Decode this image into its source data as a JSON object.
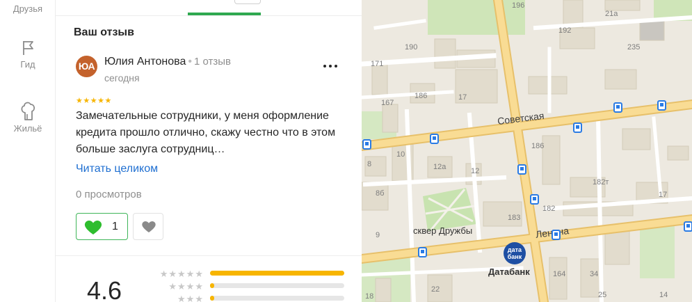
{
  "nav": {
    "items": [
      {
        "label": "Друзья",
        "icon": "friends-icon"
      },
      {
        "label": "Гид",
        "icon": "flag-icon"
      },
      {
        "label": "Жильё",
        "icon": "housing-icon"
      }
    ]
  },
  "review_section": {
    "title": "Ваш отзыв",
    "author": {
      "avatar_initials": "ЮА",
      "avatar_color": "#c4622c",
      "name": "Юлия Антонова",
      "reviews_count": "1 отзыв",
      "date": "сегодня"
    },
    "stars": "★★★★★",
    "rating_value": 5,
    "text": "Замечательные сотрудники, у меня оформление кредита прошло отлично, скажу честно что в этом больше заслуга сотрудниц…",
    "read_more": "Читать целиком",
    "views": "0 просмотров",
    "likes": {
      "count": "1",
      "icon": "green-heart-icon"
    },
    "dislike": {
      "icon": "gray-heart-icon"
    }
  },
  "summary": {
    "rating": "4.6",
    "distribution": [
      {
        "stars": "★★★★★",
        "fraction": 1.0
      },
      {
        "stars": "★★★★",
        "fraction": 0.03
      },
      {
        "stars": "★★★",
        "fraction": 0.03
      }
    ]
  },
  "map": {
    "streets": [
      "Советская",
      "Ленина"
    ],
    "places": [
      "сквер Дружбы",
      "Датабанк"
    ],
    "bank_logo_text": "дата банк",
    "building_numbers": [
      "196",
      "21а",
      "192",
      "235",
      "190",
      "171",
      "186",
      "17",
      "167",
      "186",
      "10",
      "12а",
      "12",
      "8",
      "8б",
      "182т",
      "182",
      "17",
      "183",
      "9",
      "164",
      "34",
      "22",
      "25",
      "14",
      "18"
    ]
  },
  "colors": {
    "accent_green": "#2fa84f",
    "link_blue": "#1f6fd1",
    "star_yellow": "#f7b500",
    "road_yellow": "#f6d27a",
    "bus_blue": "#2a7be4"
  }
}
